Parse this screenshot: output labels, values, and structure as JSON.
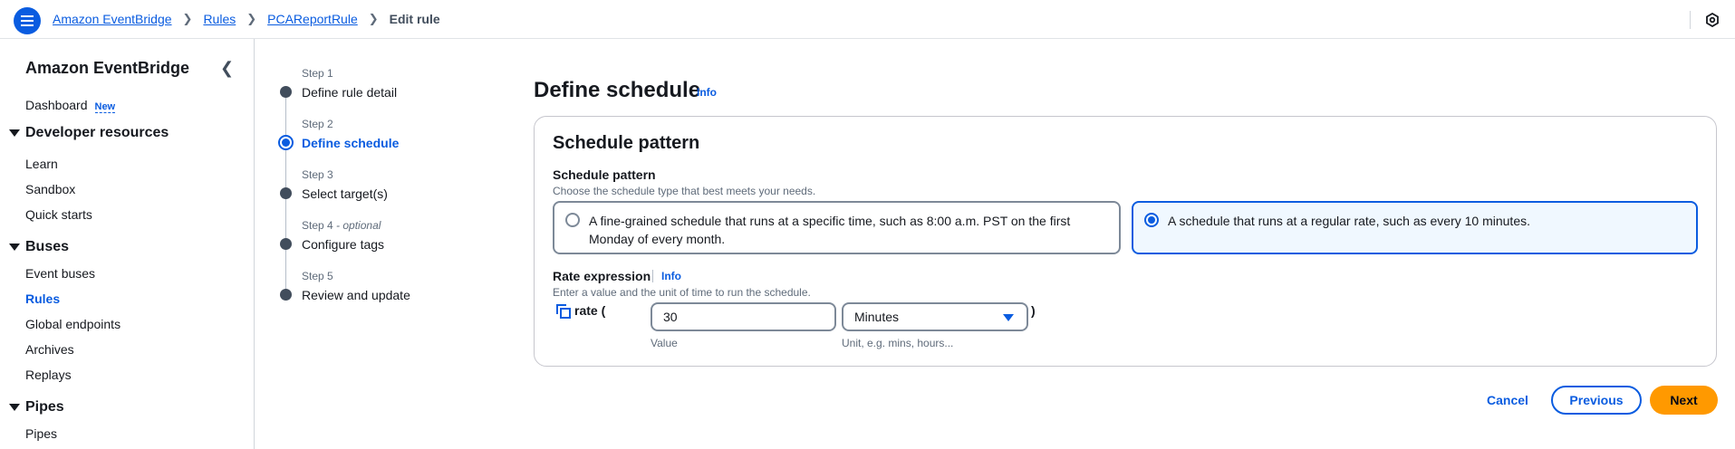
{
  "colors": {
    "accent": "#0a5ce0",
    "primary_button": "#ff9900",
    "border": "#7d8998",
    "text": "#16191f",
    "muted": "#5f6b7a"
  },
  "breadcrumb": {
    "items": [
      "Amazon EventBridge",
      "Rules",
      "PCAReportRule"
    ],
    "current": "Edit rule"
  },
  "sidebar": {
    "title": "Amazon EventBridge",
    "dashboard": "Dashboard",
    "dashboard_badge": "New",
    "sections": [
      {
        "label": "Developer resources",
        "items": [
          "Learn",
          "Sandbox",
          "Quick starts"
        ]
      },
      {
        "label": "Buses",
        "items": [
          "Event buses",
          "Rules",
          "Global endpoints",
          "Archives",
          "Replays"
        ]
      },
      {
        "label": "Pipes",
        "items": [
          "Pipes"
        ]
      }
    ],
    "active_item": "Rules"
  },
  "steps": [
    {
      "label": "Step 1",
      "optional": "",
      "name": "Define rule detail"
    },
    {
      "label": "Step 2",
      "optional": "",
      "name": "Define schedule"
    },
    {
      "label": "Step 3",
      "optional": "",
      "name": "Select target(s)"
    },
    {
      "label": "Step 4",
      "optional": " - optional",
      "name": "Configure tags"
    },
    {
      "label": "Step 5",
      "optional": "",
      "name": "Review and update"
    }
  ],
  "current_step": 2,
  "main": {
    "title": "Define schedule",
    "info": "Info",
    "panel_title": "Schedule pattern",
    "pattern_label": "Schedule pattern",
    "pattern_desc": "Choose the schedule type that best meets your needs.",
    "options": [
      {
        "text": "A fine-grained schedule that runs at a specific time, such as 8:00 a.m. PST on the first Monday of every month.",
        "selected": false
      },
      {
        "text": "A schedule that runs at a regular rate, such as every 10 minutes.",
        "selected": true
      }
    ],
    "rate_label": "Rate expression",
    "rate_info": "Info",
    "rate_desc": "Enter a value and the unit of time to run the schedule.",
    "rate_open": "rate (",
    "rate_close": ")",
    "value": "30",
    "value_label": "Value",
    "unit": "Minutes",
    "unit_label": "Unit, e.g. mins, hours..."
  },
  "footer": {
    "cancel": "Cancel",
    "previous": "Previous",
    "next": "Next"
  }
}
